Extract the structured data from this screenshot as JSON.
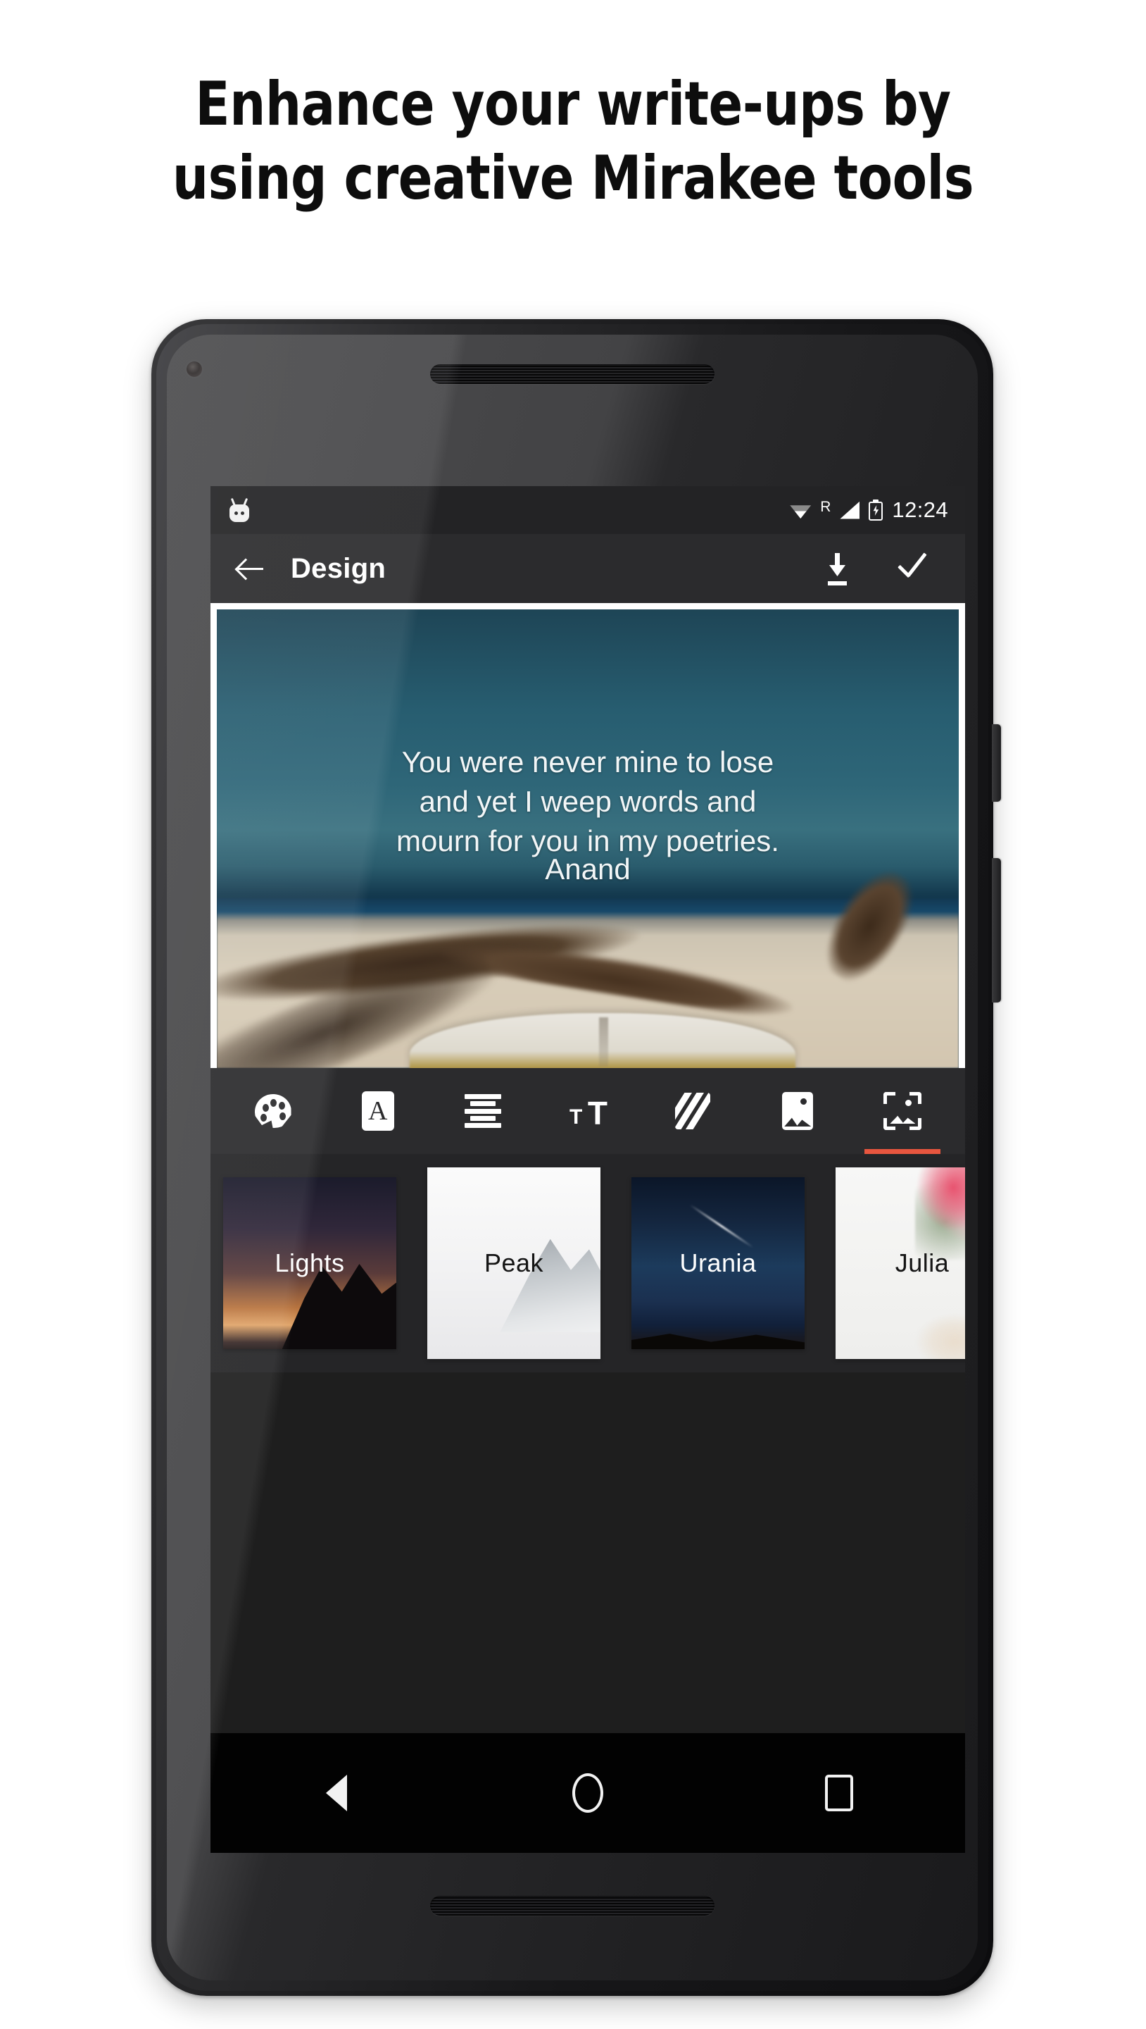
{
  "promo": {
    "headline_line1": "Enhance your write-ups by",
    "headline_line2": "using creative Mirakee tools"
  },
  "device": {
    "camera": "front-camera",
    "earpiece": "earpiece-speaker",
    "bottom_speaker": "bottom-speaker",
    "power_button": "power-button",
    "volume_button": "volume-button"
  },
  "statusbar": {
    "android_icon": "android-marshmallow-icon",
    "wifi_icon": "wifi-icon",
    "roaming": "R",
    "signal_icon": "signal-icon",
    "battery_icon": "battery-charging-icon",
    "time": "12:24"
  },
  "appbar": {
    "back_icon": "back-arrow-icon",
    "title": "Design",
    "download_icon": "download-icon",
    "done_icon": "check-icon"
  },
  "canvas": {
    "quote_line1": "You were never mine to lose",
    "quote_line2": "and yet I weep words and",
    "quote_line3": "mourn for you in my poetries.",
    "author": "Anand",
    "background_description": "open book on sand beach with driftwood"
  },
  "toolbar": {
    "items": [
      {
        "name": "palette",
        "icon": "palette-icon",
        "active": false
      },
      {
        "name": "font",
        "icon": "font-a-icon",
        "active": false
      },
      {
        "name": "align",
        "icon": "text-align-icon",
        "active": false
      },
      {
        "name": "text-size",
        "icon": "text-size-icon",
        "active": false
      },
      {
        "name": "texture",
        "icon": "diagonal-stripes-icon",
        "active": false
      },
      {
        "name": "image",
        "icon": "image-icon",
        "active": false
      },
      {
        "name": "frame-image",
        "icon": "framed-image-icon",
        "active": true
      }
    ],
    "active_indicator_color": "#e8563f"
  },
  "thumbnails": [
    {
      "label": "Lights",
      "theme": "night-mountain-lake"
    },
    {
      "label": "Peak",
      "theme": "white-snowy-peak"
    },
    {
      "label": "Urania",
      "theme": "blue-starry-sky"
    },
    {
      "label": "Julia",
      "theme": "white-pink-flowers"
    }
  ],
  "navbar": {
    "back_icon": "nav-back-triangle-icon",
    "home_icon": "nav-home-circle-icon",
    "recents_icon": "nav-recents-square-icon"
  }
}
